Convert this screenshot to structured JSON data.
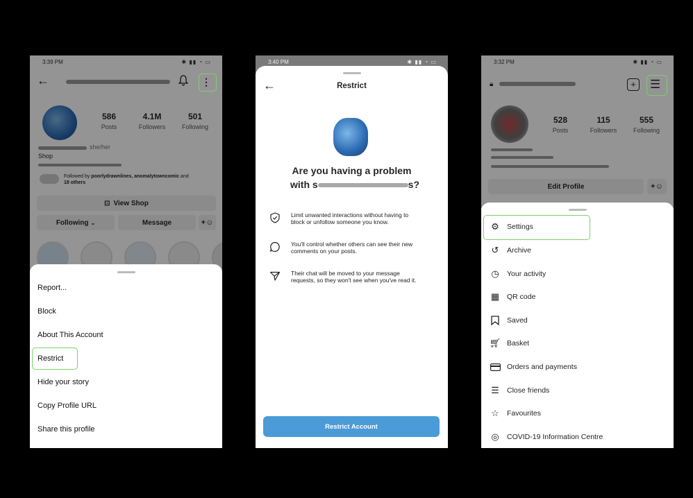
{
  "colors": {
    "highlight": "#7bd26a",
    "primary_button": "#4c9bd9",
    "overlay": "rgba(0,0,0,0.42)"
  },
  "panel1": {
    "status_time": "3:39 PM",
    "stats": [
      {
        "value": "586",
        "label": "Posts"
      },
      {
        "value": "4.1M",
        "label": "Followers"
      },
      {
        "value": "501",
        "label": "Following"
      }
    ],
    "pronouns": "she/her",
    "shop_label": "Shop",
    "followed_by_prefix": "Followed by ",
    "followed_by_names": "poorlydrawnlines, anomalytowncomic",
    "followed_by_and": " and",
    "followed_by_others": "18 others",
    "view_shop": "View Shop",
    "following_button": "Following",
    "message_button": "Message",
    "menu": [
      "Report...",
      "Block",
      "About This Account",
      "Restrict",
      "Hide your story",
      "Copy Profile URL",
      "Share this profile"
    ]
  },
  "panel2": {
    "status_time": "3:40 PM",
    "title": "Restrict",
    "question_line1": "Are you having a problem",
    "question_line2_prefix": "with s",
    "question_line2_suffix": "s?",
    "bullets": [
      {
        "icon": "shield-check-icon",
        "text": "Limit unwanted interactions without having to block or unfollow someone you know."
      },
      {
        "icon": "comment-bubble-icon",
        "text": "You'll control whether others can see their new comments on your posts."
      },
      {
        "icon": "paper-plane-icon",
        "text": "Their chat will be moved to your message requests, so they won't see when you've read it."
      }
    ],
    "restrict_button": "Restrict Account"
  },
  "panel3": {
    "status_time": "3:32 PM",
    "stats": [
      {
        "value": "528",
        "label": "Posts"
      },
      {
        "value": "115",
        "label": "Followers"
      },
      {
        "value": "555",
        "label": "Following"
      }
    ],
    "edit_profile": "Edit Profile",
    "menu": [
      {
        "label": "Settings",
        "icon": "settings-icon"
      },
      {
        "label": "Archive",
        "icon": "archive-icon"
      },
      {
        "label": "Your activity",
        "icon": "activity-icon"
      },
      {
        "label": "QR code",
        "icon": "qr-code-icon"
      },
      {
        "label": "Saved",
        "icon": "bookmark-icon"
      },
      {
        "label": "Basket",
        "icon": "cart-icon"
      },
      {
        "label": "Orders and payments",
        "icon": "card-icon"
      },
      {
        "label": "Close friends",
        "icon": "list-icon"
      },
      {
        "label": "Favourites",
        "icon": "star-icon"
      },
      {
        "label": "COVID-19 Information Centre",
        "icon": "covid-info-icon"
      }
    ]
  }
}
